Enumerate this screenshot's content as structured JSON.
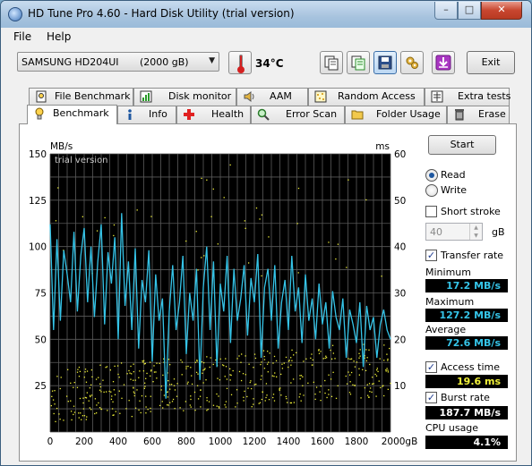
{
  "window": {
    "title": "HD Tune Pro 4.60 - Hard Disk Utility (trial version)",
    "minimize": "–",
    "maximize": "□",
    "close": "✕"
  },
  "menu": {
    "file": "File",
    "help": "Help"
  },
  "toolbar": {
    "drive_name": "SAMSUNG HD204UI",
    "drive_size": "(2000 gB)",
    "temperature": "34°C",
    "exit_label": "Exit",
    "icons": [
      "copy-icon",
      "copy-green-icon",
      "save-icon",
      "options-icon",
      "download-icon"
    ]
  },
  "tabs_top": [
    {
      "label": "File Benchmark",
      "icon": "file-benchmark-icon"
    },
    {
      "label": "Disk monitor",
      "icon": "disk-monitor-icon"
    },
    {
      "label": "AAM",
      "icon": "speaker-icon"
    },
    {
      "label": "Random Access",
      "icon": "random-access-icon"
    },
    {
      "label": "Extra tests",
      "icon": "extra-tests-icon"
    }
  ],
  "tabs_bottom": [
    {
      "label": "Benchmark",
      "icon": "benchmark-icon",
      "active": true
    },
    {
      "label": "Info",
      "icon": "info-icon"
    },
    {
      "label": "Health",
      "icon": "health-cross-icon"
    },
    {
      "label": "Error Scan",
      "icon": "magnifier-icon"
    },
    {
      "label": "Folder Usage",
      "icon": "folder-icon"
    },
    {
      "label": "Erase",
      "icon": "trash-icon"
    }
  ],
  "controls": {
    "start_label": "Start",
    "read_label": "Read",
    "write_label": "Write",
    "mode_selected": "Read",
    "short_stroke_label": "Short stroke",
    "short_stroke_checked": false,
    "short_stroke_value": "40",
    "short_stroke_unit": "gB",
    "transfer_rate_label": "Transfer rate",
    "transfer_rate_checked": true,
    "access_time_label": "Access time",
    "access_time_checked": true,
    "burst_rate_label": "Burst rate",
    "burst_rate_checked": true
  },
  "stats": {
    "minimum_label": "Minimum",
    "minimum": "17.2 MB/s",
    "maximum_label": "Maximum",
    "maximum": "127.2 MB/s",
    "average_label": "Average",
    "average": "72.6 MB/s",
    "access_time": "19.6 ms",
    "burst_rate": "187.7 MB/s",
    "cpu_label": "CPU usage",
    "cpu": "4.1%"
  },
  "chart_data": {
    "type": "line",
    "watermark": "trial version",
    "y_left_unit": "MB/s",
    "y_right_unit": "ms",
    "x_unit": "gB",
    "x_ticks": [
      "0",
      "200",
      "400",
      "600",
      "800",
      "1000",
      "1200",
      "1400",
      "1600",
      "1800",
      "2000"
    ],
    "y_left_ticks": [
      "150",
      "125",
      "100",
      "75",
      "50",
      "25"
    ],
    "y_right_ticks": [
      "60",
      "50",
      "40",
      "30",
      "20",
      "10"
    ],
    "xlim": [
      0,
      2000
    ],
    "ylim_left": [
      0,
      150
    ],
    "ylim_right": [
      0,
      60
    ],
    "grid": true,
    "series": [
      {
        "color": "#35c4e8",
        "x": [
          0,
          20,
          40,
          60,
          80,
          100,
          120,
          140,
          160,
          180,
          200,
          220,
          240,
          260,
          280,
          300,
          320,
          340,
          360,
          380,
          400,
          420,
          440,
          460,
          480,
          500,
          520,
          540,
          560,
          580,
          600,
          620,
          640,
          660,
          680,
          700,
          720,
          740,
          760,
          780,
          800,
          820,
          840,
          860,
          880,
          900,
          920,
          940,
          960,
          980,
          1000,
          1020,
          1040,
          1060,
          1080,
          1100,
          1120,
          1140,
          1160,
          1180,
          1200,
          1220,
          1240,
          1260,
          1280,
          1300,
          1320,
          1340,
          1360,
          1380,
          1400,
          1420,
          1440,
          1460,
          1480,
          1500,
          1520,
          1540,
          1560,
          1580,
          1600,
          1620,
          1640,
          1660,
          1680,
          1700,
          1720,
          1740,
          1760,
          1780,
          1800,
          1820,
          1840,
          1860,
          1880,
          1900,
          1920,
          1940,
          1960,
          1980,
          2000
        ],
        "values": [
          112,
          55,
          104,
          60,
          98,
          85,
          70,
          108,
          65,
          95,
          110,
          70,
          100,
          62,
          92,
          112,
          58,
          97,
          80,
          105,
          50,
          118,
          68,
          92,
          55,
          99,
          45,
          82,
          70,
          98,
          38,
          85,
          60,
          72,
          18,
          65,
          90,
          55,
          70,
          95,
          42,
          75,
          60,
          88,
          28,
          78,
          100,
          55,
          92,
          35,
          80,
          65,
          95,
          48,
          88,
          60,
          72,
          90,
          52,
          83,
          70,
          96,
          40,
          78,
          88,
          60,
          90,
          45,
          70,
          82,
          55,
          95,
          65,
          78,
          48,
          85,
          60,
          72,
          50,
          80,
          58,
          70,
          45,
          76,
          62,
          55,
          72,
          40,
          66,
          58,
          48,
          70,
          35,
          68,
          55,
          62,
          40,
          58,
          66,
          55,
          50
        ]
      }
    ],
    "access_points": {
      "color": "#f2f239",
      "note": "scattered access-time samples, mostly between 5 and 22 ms"
    }
  }
}
